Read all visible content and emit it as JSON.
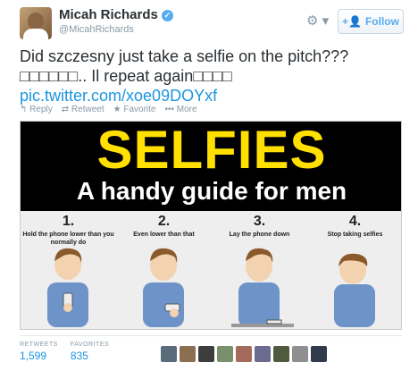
{
  "header": {
    "display_name": "Micah Richards",
    "handle": "@MicahRichards",
    "follow_label": "Follow",
    "gear_icon": "gear-icon"
  },
  "tweet": {
    "text": "Did szczesny just take a selfie on the pitch??? □□□□□□.. Il repeat again□□□□",
    "link": "pic.twitter.com/xoe09DOYxf"
  },
  "actions": {
    "reply": "Reply",
    "retweet": "Retweet",
    "favorite": "Favorite",
    "more": "More"
  },
  "media": {
    "title": "SELFIES",
    "subtitle": "A handy guide for men",
    "steps": [
      {
        "num": "1.",
        "caption": "Hold the phone lower than you normally do"
      },
      {
        "num": "2.",
        "caption": "Even lower than that"
      },
      {
        "num": "3.",
        "caption": "Lay the phone down"
      },
      {
        "num": "4.",
        "caption": "Stop taking selfies"
      }
    ]
  },
  "stats": {
    "retweets_label": "RETWEETS",
    "retweets_value": "1,599",
    "favorites_label": "FAVORITES",
    "favorites_value": "835"
  },
  "colors": {
    "accent": "#1b95e0",
    "banner_yellow": "#ffe000",
    "shirt_blue": "#6d93c8"
  }
}
